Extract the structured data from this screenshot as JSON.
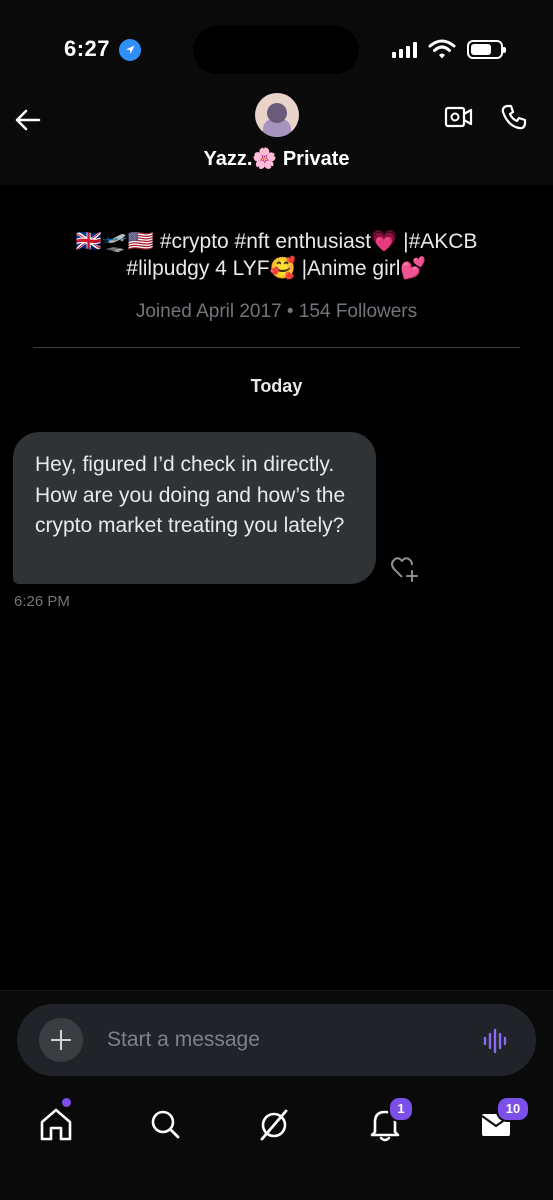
{
  "status_bar": {
    "time": "6:27"
  },
  "header": {
    "back_icon": "arrow-left-icon",
    "name": "Yazz.🌸 Private",
    "video_icon": "video-call-icon",
    "phone_icon": "phone-icon"
  },
  "profile": {
    "bio_line1": "🇬🇧🛫🇺🇸 #crypto #nft enthusiast💗 |#AKCB",
    "bio_line2": "#lilpudgy 4 LYF🥰 |Anime girl💕",
    "meta": "Joined April 2017 • 154 Followers"
  },
  "conversation": {
    "date_label": "Today",
    "messages": [
      {
        "text": "Hey, figured I’d check in directly. How are you doing and how’s the crypto market treating you lately?",
        "time": "6:26 PM"
      }
    ]
  },
  "composer": {
    "placeholder": "Start a message",
    "value": ""
  },
  "tab_bar": {
    "notifications_badge": "1",
    "messages_badge": "10"
  },
  "colors": {
    "accent": "#7b4fe8",
    "bubble": "#2f3336",
    "muted_text": "#71767b",
    "background": "#000000"
  }
}
